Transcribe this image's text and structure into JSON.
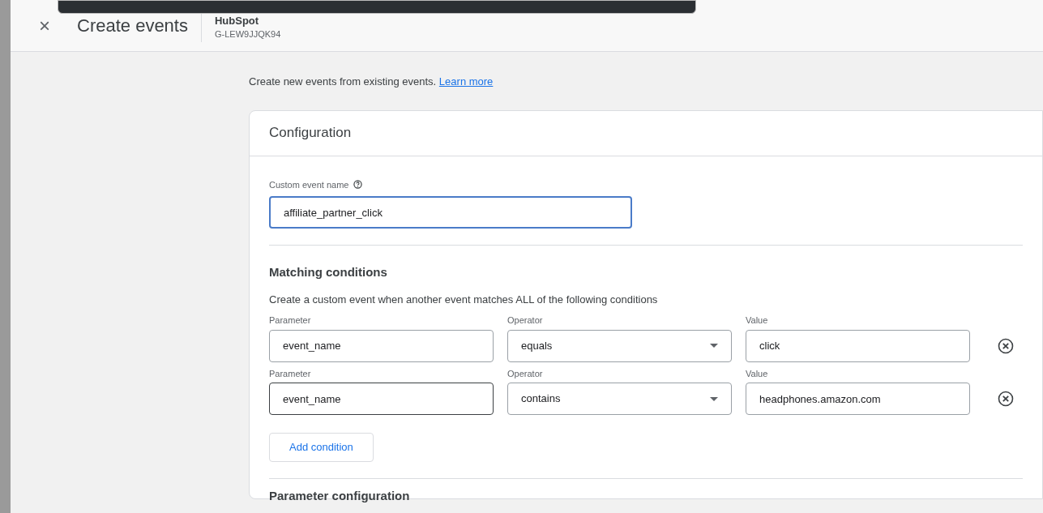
{
  "header": {
    "close_icon": "×",
    "title": "Create events",
    "property_name": "HubSpot",
    "property_id": "G-LEW9JJQK94"
  },
  "intro": {
    "text": "Create new events from existing events.",
    "link": "Learn more"
  },
  "configuration": {
    "title": "Configuration",
    "custom_event_name": {
      "label": "Custom event name",
      "value": "affiliate_partner_click",
      "focused": true
    },
    "matching_conditions": {
      "title": "Matching conditions",
      "description": "Create a custom event when another event matches ALL of the following conditions",
      "conditions": [
        {
          "parameter_label": "Parameter",
          "parameter": "event_name",
          "parameter_hovered": false,
          "operator_label": "Operator",
          "operator": "equals",
          "value_label": "Value",
          "value": "click"
        },
        {
          "parameter_label": "Parameter",
          "parameter": "event_name",
          "parameter_hovered": true,
          "operator_label": "Operator",
          "operator": "contains",
          "value_label": "Value",
          "value": "headphones.amazon.com"
        }
      ],
      "add_button": "Add condition"
    },
    "next_section_title": "Parameter configuration"
  }
}
